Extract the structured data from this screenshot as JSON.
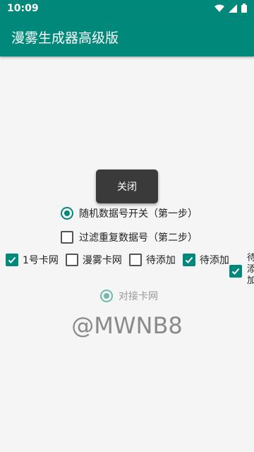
{
  "status_bar": {
    "time": "10:09"
  },
  "app_bar": {
    "title": "漫雾生成器高级版"
  },
  "close_button": {
    "label": "关闭"
  },
  "radio_random": {
    "label": "随机数据号开关（第一步）"
  },
  "check_filter": {
    "label": "过滤重复数据号（第二步）"
  },
  "card_checks": [
    {
      "label": "1号卡网",
      "checked": true
    },
    {
      "label": "漫雾卡网",
      "checked": false
    },
    {
      "label": "待添加",
      "checked": false
    },
    {
      "label": "待添加",
      "checked": true
    }
  ],
  "overflow_check": {
    "label": "待添加",
    "checked": true
  },
  "radio_dock": {
    "label": "对接卡网"
  },
  "watermark": {
    "text": "@MWNB8"
  }
}
